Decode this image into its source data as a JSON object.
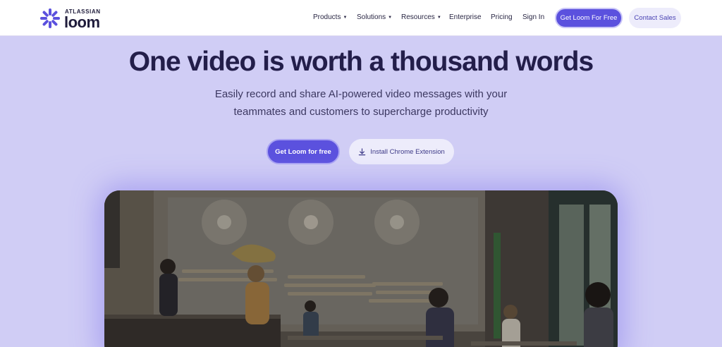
{
  "brand": {
    "company": "ATLASSIAN",
    "product": "loom",
    "accent": "#5b51de"
  },
  "nav": {
    "items": [
      {
        "label": "Products",
        "dropdown": true
      },
      {
        "label": "Solutions",
        "dropdown": true
      },
      {
        "label": "Resources",
        "dropdown": true
      },
      {
        "label": "Enterprise",
        "dropdown": false
      },
      {
        "label": "Pricing",
        "dropdown": false
      },
      {
        "label": "Sign In",
        "dropdown": false
      }
    ],
    "primary_cta": "Get Loom For Free",
    "secondary_cta": "Contact Sales",
    "caret": "▼"
  },
  "hero": {
    "title": "One video is worth a thousand words",
    "subtitle_line1": "Easily record and share AI-powered video messages with your",
    "subtitle_line2": "teammates and customers to supercharge productivity",
    "primary_cta": "Get Loom for free",
    "secondary_cta": "Install Chrome Extension",
    "secondary_icon": "download-icon"
  },
  "video": {
    "icon": "cafe-office-video-still"
  }
}
